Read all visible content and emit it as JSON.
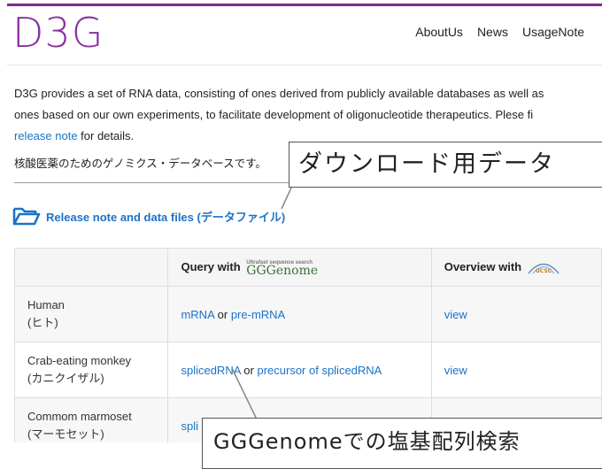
{
  "header": {
    "logo": "D3G",
    "nav": [
      "AboutUs",
      "News",
      "UsageNote"
    ]
  },
  "intro": {
    "line1": "D3G provides a set of RNA data, consisting of ones derived from publicly available databases as well as",
    "line2": "ones based on our own experiments, to facilitate development of oligonucleotide therapeutics. Plese fi",
    "link": "release note",
    "line3_rest": " for details."
  },
  "jp_text": "核酸医薬のためのゲノミクス・データベースです。",
  "release": {
    "label": "Release note and data files (データファイル)",
    "icon": "folder-open-icon"
  },
  "table": {
    "headers": [
      "",
      "Query with",
      "Overview with"
    ],
    "gggenome_logo_small": "Ultrafast sequence search",
    "gggenome_logo": "GGGenome",
    "rows": [
      {
        "species": "Human",
        "species_jp": "(ヒト)",
        "query_a": "mRNA",
        "or": " or ",
        "query_b": "pre-mRNA",
        "overview": "view"
      },
      {
        "species": "Crab-eating monkey",
        "species_jp": "(カニクイザル)",
        "query_a": "splicedRNA",
        "or": " or ",
        "query_b": "precursor of splicedRNA",
        "overview": "view"
      },
      {
        "species": "Commom marmoset",
        "species_jp": "(マーモセット)",
        "query_a": "spli",
        "or": "",
        "query_b": "",
        "overview": ""
      }
    ]
  },
  "callouts": {
    "download": "ダウンロード用データ",
    "search": "GGGenomeでの塩基配列検索"
  },
  "colors": {
    "brand": "#8a2fa0",
    "link": "#1a73c8"
  }
}
